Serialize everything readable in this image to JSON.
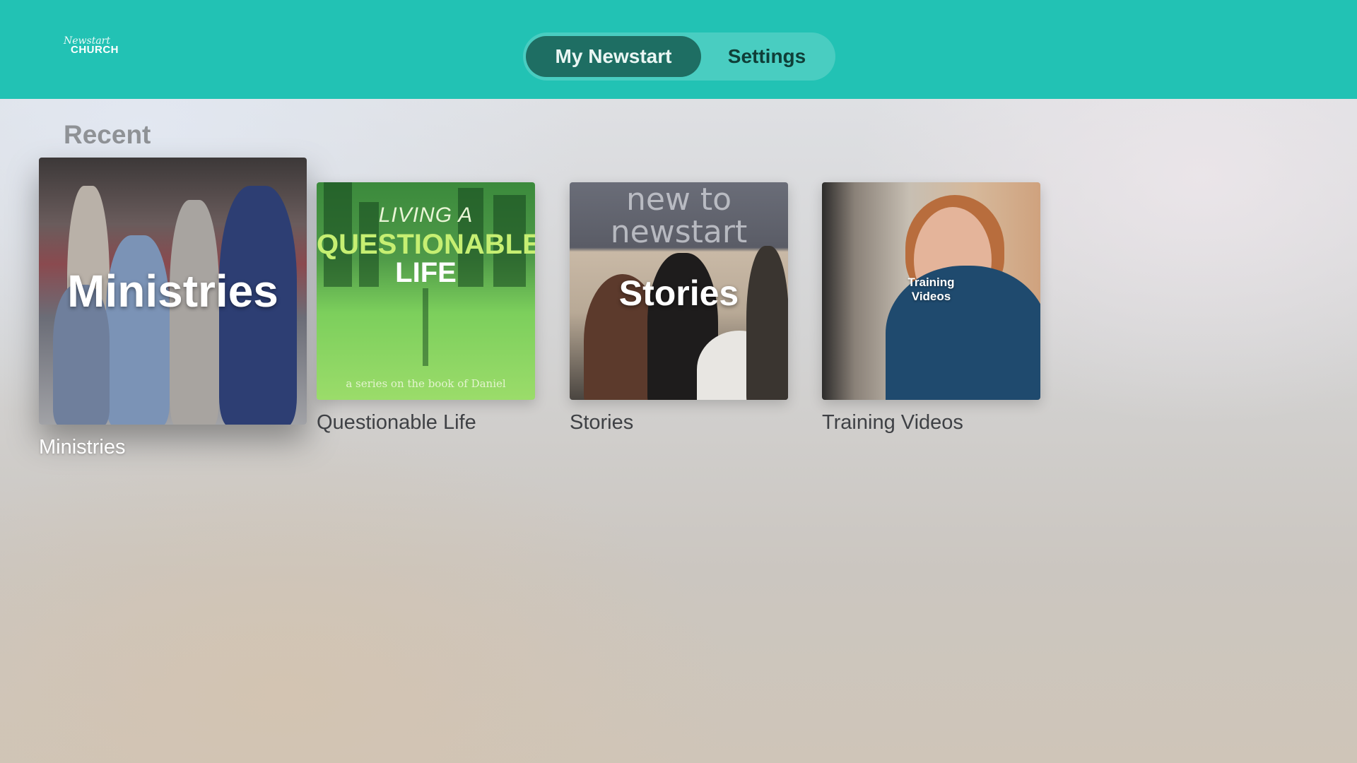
{
  "header": {
    "logo": {
      "script_text": "Newstart",
      "word_text": "CHURCH"
    },
    "tabs": [
      {
        "label": "My Newstart",
        "selected": true
      },
      {
        "label": "Settings",
        "selected": false
      }
    ],
    "colors": {
      "bar": "#22c2b4",
      "active_tab": "#1e6e63"
    }
  },
  "main": {
    "section_title": "Recent",
    "cards": [
      {
        "caption": "Ministries",
        "overlay_title": "Ministries",
        "focused": true
      },
      {
        "caption": "Questionable Life",
        "art_line1": "LIVING A",
        "art_line2": "QUESTIONABLE",
        "art_line3": "LIFE",
        "art_subtitle": "a series on the book of Daniel",
        "focused": false
      },
      {
        "caption": "Stories",
        "overlay_title": "Stories",
        "banner_line1": "new to",
        "banner_line2": "newstart",
        "focused": false
      },
      {
        "caption": "Training Videos",
        "overlay_line1": "Training",
        "overlay_line2": "Videos",
        "focused": false
      }
    ]
  }
}
